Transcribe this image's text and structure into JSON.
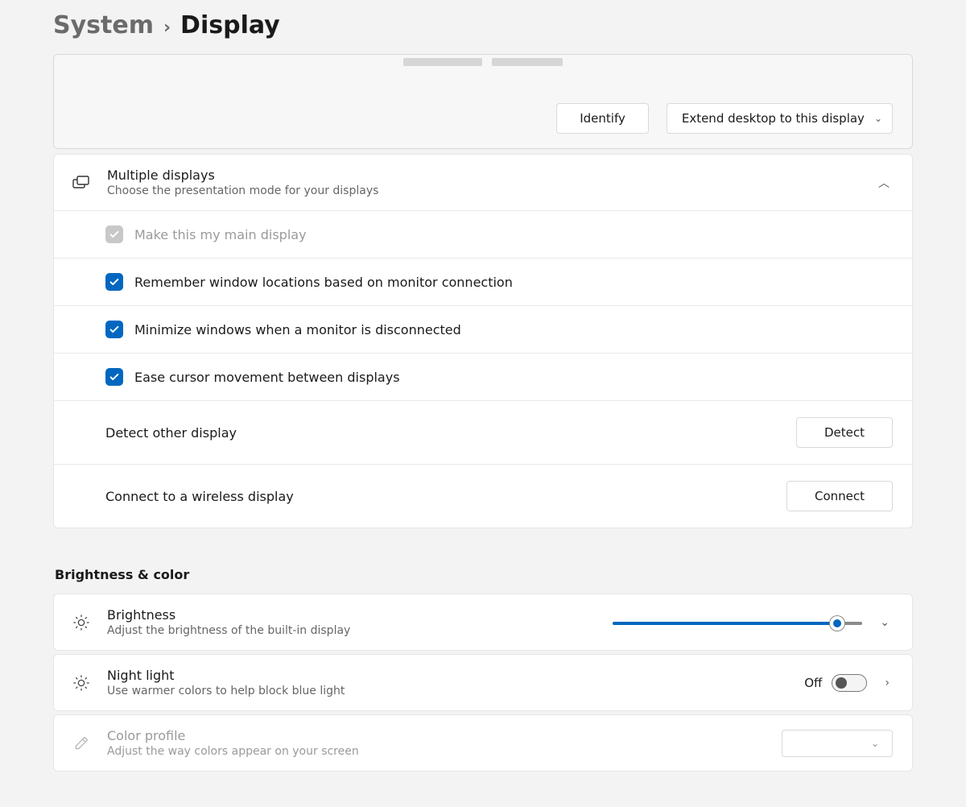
{
  "breadcrumb": {
    "parent": "System",
    "current": "Display"
  },
  "arrange": {
    "identify_btn": "Identify",
    "mode_dropdown": "Extend desktop to this display"
  },
  "multi": {
    "title": "Multiple displays",
    "subtitle": "Choose the presentation mode for your displays",
    "items": [
      {
        "label": "Make this my main display",
        "checked": true,
        "disabled": true
      },
      {
        "label": "Remember window locations based on monitor connection",
        "checked": true,
        "disabled": false
      },
      {
        "label": "Minimize windows when a monitor is disconnected",
        "checked": true,
        "disabled": false
      },
      {
        "label": "Ease cursor movement between displays",
        "checked": true,
        "disabled": false
      }
    ],
    "detect": {
      "label": "Detect other display",
      "button": "Detect"
    },
    "wireless": {
      "label": "Connect to a wireless display",
      "button": "Connect"
    }
  },
  "section_brightness": "Brightness & color",
  "brightness": {
    "title": "Brightness",
    "subtitle": "Adjust the brightness of the built-in display",
    "value_pct": 90
  },
  "nightlight": {
    "title": "Night light",
    "subtitle": "Use warmer colors to help block blue light",
    "state_label": "Off",
    "on": false
  },
  "colorprofile": {
    "title": "Color profile",
    "subtitle": "Adjust the way colors appear on your screen",
    "disabled": true
  }
}
